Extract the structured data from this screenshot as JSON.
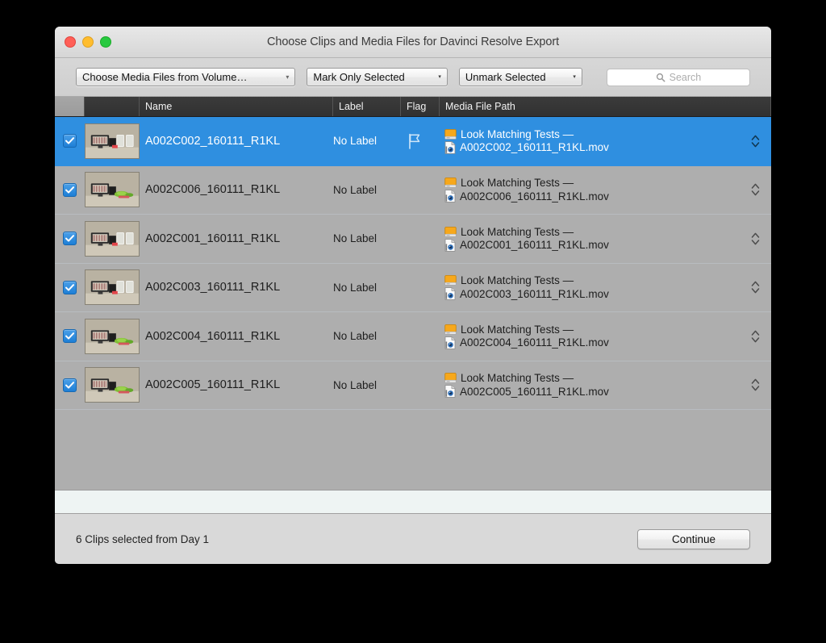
{
  "window": {
    "title": "Choose Clips and Media Files for Davinci Resolve Export",
    "traffic_lights": {
      "close": "close-button",
      "minimize": "minimize-button",
      "zoom": "zoom-button"
    }
  },
  "toolbar": {
    "volume_popup": "Choose Media Files from Volume…",
    "mark_popup": "Mark Only Selected",
    "unmark_popup": "Unmark Selected",
    "search_placeholder": "Search",
    "search_value": "",
    "caret_glyph": "▾"
  },
  "table": {
    "columns": [
      {
        "key": "check",
        "label": ""
      },
      {
        "key": "thumb",
        "label": ""
      },
      {
        "key": "name",
        "label": "Name"
      },
      {
        "key": "label",
        "label": "Label"
      },
      {
        "key": "flag",
        "label": "Flag"
      },
      {
        "key": "path",
        "label": "Media File Path"
      }
    ],
    "rows": [
      {
        "checked": true,
        "selected": true,
        "name": "A002C002_160111_R1KL",
        "label": "No Label",
        "flag": "flag-outline-icon",
        "volume": "Look Matching Tests —",
        "file": "A002C002_160111_R1KL.mov",
        "thumb_variant": "glasses"
      },
      {
        "checked": true,
        "selected": false,
        "name": "A002C006_160111_R1KL",
        "label": "No Label",
        "flag": "",
        "volume": "Look Matching Tests —",
        "file": "A002C006_160111_R1KL.mov",
        "thumb_variant": "greens"
      },
      {
        "checked": true,
        "selected": false,
        "name": "A002C001_160111_R1KL",
        "label": "No Label",
        "flag": "",
        "volume": "Look Matching Tests —",
        "file": "A002C001_160111_R1KL.mov",
        "thumb_variant": "glasses"
      },
      {
        "checked": true,
        "selected": false,
        "name": "A002C003_160111_R1KL",
        "label": "No Label",
        "flag": "",
        "volume": "Look Matching Tests —",
        "file": "A002C003_160111_R1KL.mov",
        "thumb_variant": "glasses"
      },
      {
        "checked": true,
        "selected": false,
        "name": "A002C004_160111_R1KL",
        "label": "No Label",
        "flag": "",
        "volume": "Look Matching Tests —",
        "file": "A002C004_160111_R1KL.mov",
        "thumb_variant": "greens"
      },
      {
        "checked": true,
        "selected": false,
        "name": "A002C005_160111_R1KL",
        "label": "No Label",
        "flag": "",
        "volume": "Look Matching Tests —",
        "file": "A002C005_160111_R1KL.mov",
        "thumb_variant": "greens"
      }
    ]
  },
  "footer": {
    "status": "6 Clips selected from Day 1",
    "continue_label": "Continue"
  },
  "colors": {
    "selection_blue": "#2f8fe0",
    "list_gray": "#aeaeae",
    "header_dark": "#353535",
    "drive_orange": "#f7a81b",
    "strip_mint": "#eef4f3"
  }
}
